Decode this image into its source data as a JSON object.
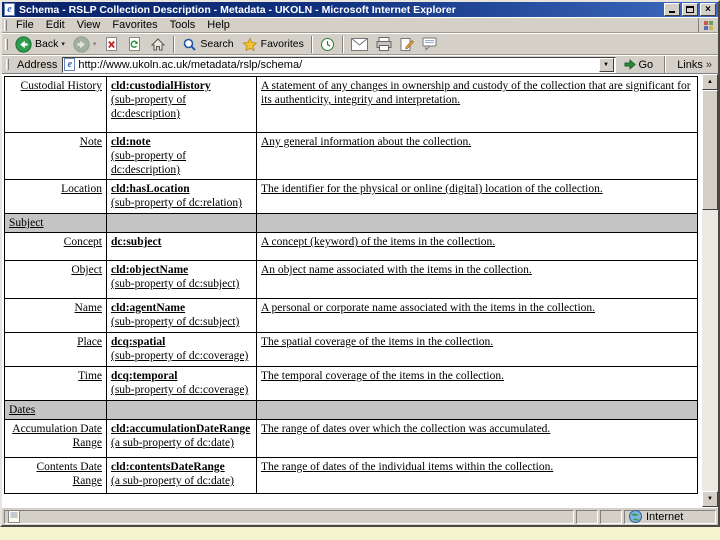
{
  "window": {
    "title": "Schema - RSLP Collection Description - Metadata - UKOLN - Microsoft Internet Explorer"
  },
  "icons": {
    "ie_logo": "e",
    "close": "×",
    "caret_down": "▾",
    "dropdown": "▼",
    "arrow_up": "▲",
    "arrow_down": "▼",
    "chevron": "»"
  },
  "menu": {
    "items": [
      "File",
      "Edit",
      "View",
      "Favorites",
      "Tools",
      "Help"
    ]
  },
  "toolbar": {
    "back_label": "Back",
    "search_label": "Search",
    "favorites_label": "Favorites"
  },
  "address": {
    "label": "Address",
    "url": "http://www.ukoln.ac.uk/metadata/rslp/schema/",
    "go_label": "Go",
    "links_label": "Links"
  },
  "statusbar": {
    "zone_label": "Internet"
  },
  "content": {
    "rows": [
      {
        "type": "property",
        "label": "Custodial History",
        "element": "cld:custodialHistory",
        "qualifier": "(sub-property of dc:description)",
        "desc": "A statement of any changes in ownership and custody of the collection that are significant for its authenticity, integrity and interpretation."
      },
      {
        "type": "property",
        "label": "Note",
        "element": "cld:note",
        "qualifier": "(sub-property of dc:description)",
        "desc": "Any general information about the collection."
      },
      {
        "type": "property",
        "label": "Location",
        "element": "cld:hasLocation",
        "qualifier": "(sub-property of dc:relation)",
        "desc": "The identifier for the physical or online (digital) location of the collection."
      },
      {
        "type": "section",
        "label": "Subject"
      },
      {
        "type": "property",
        "label": "Concept",
        "element": "dc:subject",
        "qualifier": "",
        "desc": "A concept (keyword) of the items in the collection."
      },
      {
        "type": "property",
        "label": "Object",
        "element": "cld:objectName",
        "qualifier": "(sub-property of dc:subject)",
        "desc": "An object name associated with the items in the collection."
      },
      {
        "type": "property",
        "label": "Name",
        "element": "cld:agentName",
        "qualifier": "(sub-property of dc:subject)",
        "desc": "A personal or corporate name associated with the items in the collection."
      },
      {
        "type": "property",
        "label": "Place",
        "element": "dcq:spatial",
        "qualifier": "(sub-property of dc:coverage)",
        "desc": "The spatial coverage of the items in the collection."
      },
      {
        "type": "property",
        "label": "Time",
        "element": "dcq:temporal",
        "qualifier": "(sub-property of dc:coverage)",
        "desc": "The temporal coverage of the items in the collection."
      },
      {
        "type": "section",
        "label": "Dates"
      },
      {
        "type": "property",
        "label": "Accumulation Date Range",
        "element": "cld:accumulationDateRange",
        "qualifier": "(a sub-property of dc:date)",
        "desc": "The range of dates over which the collection was accumulated."
      },
      {
        "type": "property",
        "label": "Contents Date Range",
        "element": "cld:contentsDateRange",
        "qualifier": "(a sub-property of dc:date)",
        "desc": "The range of dates of the individual items within the collection."
      }
    ]
  }
}
